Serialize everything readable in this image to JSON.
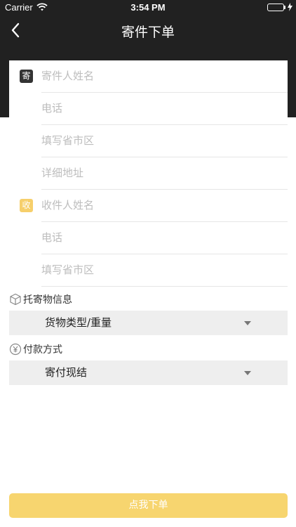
{
  "status_bar": {
    "carrier": "Carrier",
    "time": "3:54 PM"
  },
  "nav": {
    "title": "寄件下单",
    "back_icon": "chevron-left-icon"
  },
  "sender": {
    "badge": "寄",
    "name_placeholder": "寄件人姓名",
    "phone_placeholder": "电话",
    "region_placeholder": "填写省市区",
    "address_placeholder": "详细地址"
  },
  "receiver": {
    "badge": "收",
    "name_placeholder": "收件人姓名",
    "phone_placeholder": "电话",
    "region_placeholder": "填写省市区"
  },
  "cargo": {
    "label": "托寄物信息",
    "icon": "package-icon",
    "select_value": "货物类型/重量"
  },
  "payment": {
    "label": "付款方式",
    "icon": "yen-icon",
    "select_value": "寄付现结"
  },
  "submit_label": "点我下单",
  "colors": {
    "header": "#212121",
    "accent": "#f7d56f",
    "receiver_badge": "#f6cf6b",
    "battery": "#4cd964"
  }
}
